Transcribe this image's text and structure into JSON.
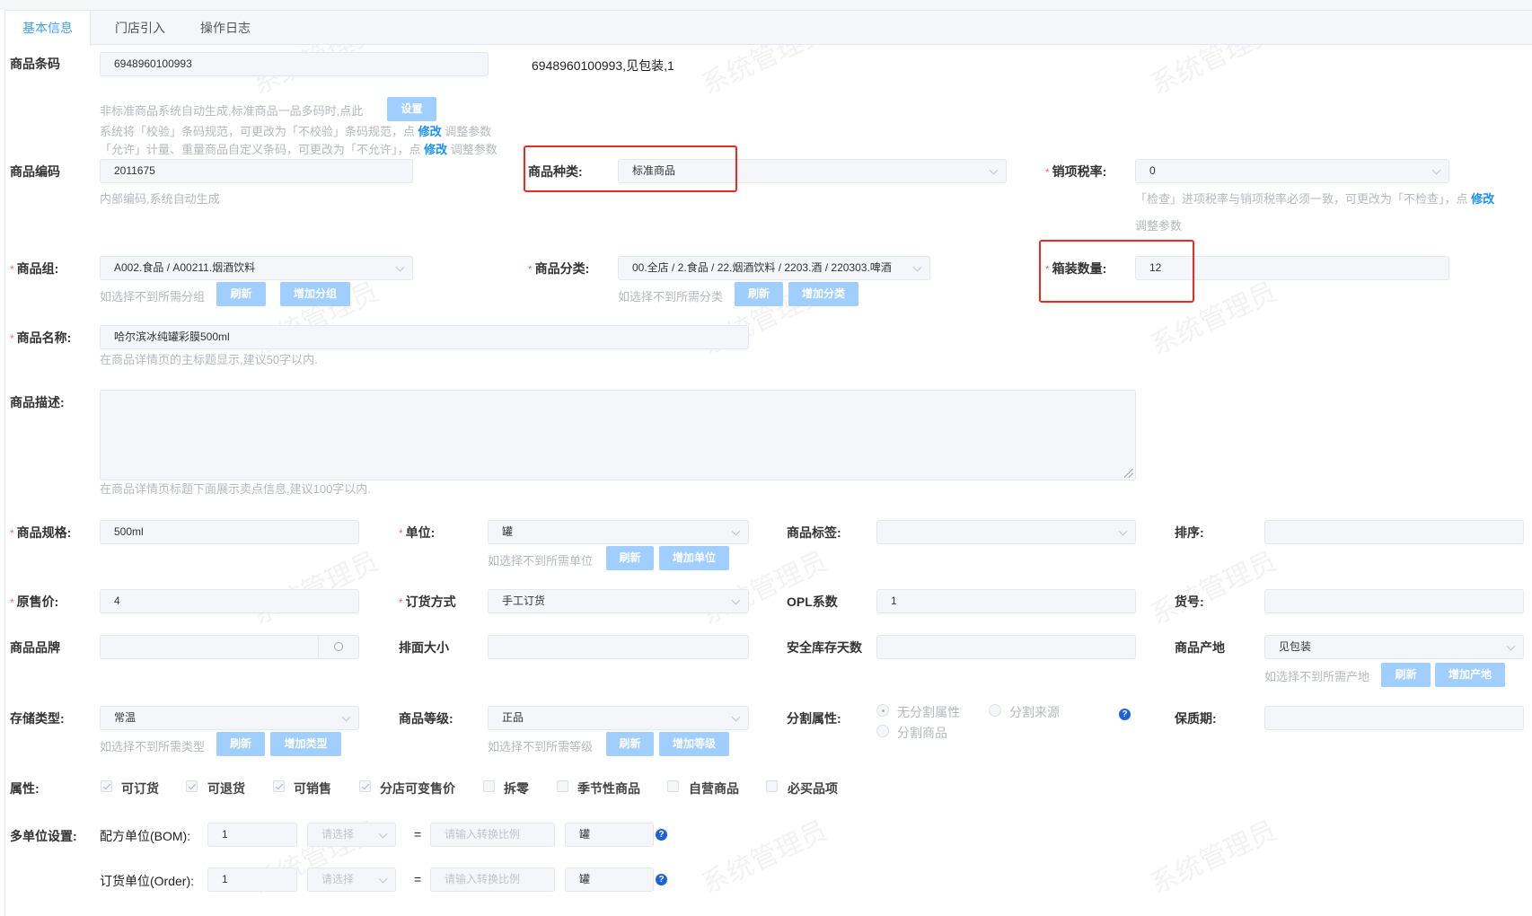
{
  "watermark": "系统管理员",
  "tabs": [
    {
      "label": "基本信息",
      "active": true
    },
    {
      "label": "门店引入"
    },
    {
      "label": "操作日志"
    }
  ],
  "barcode": {
    "label": "商品条码",
    "value": "6948960100993",
    "summary": "6948960100993,见包装,1",
    "hint1": "非标准商品系统自动生成,标准商品一品多码时,点此",
    "set_button": "设置",
    "hint2_pre": "系统将「校验」条码规范，可更改为「不校验」条码规范，点",
    "hint3_pre": "「允许」计量、重量商品自定义条码，可更改为「不允许」，点",
    "modify": "修改",
    "adjust": "调整参数"
  },
  "code": {
    "label": "商品编码",
    "value": "2011675",
    "hint": "内部编码,系统自动生成"
  },
  "kind": {
    "label": "商品种类:",
    "value": "标准商品"
  },
  "tax": {
    "label": "销项税率:",
    "value": "0",
    "hint_pre": "「检查」进项税率与销项税率必须一致，可更改为「不检查」，点",
    "modify": "修改",
    "adjust": "调整参数"
  },
  "group": {
    "label": "商品组:",
    "value": "A002.食品 / A00211.烟酒饮料",
    "hint": "如选择不到所需分组",
    "refresh": "刷新",
    "add": "增加分组"
  },
  "category": {
    "label": "商品分类:",
    "value": "00.全店 / 2.食品 / 22.烟酒饮料 / 2203.酒 / 220303.啤酒",
    "hint": "如选择不到所需分类",
    "refresh": "刷新",
    "add": "增加分类"
  },
  "box_qty": {
    "label": "箱装数量:",
    "value": "12"
  },
  "name": {
    "label": "商品名称:",
    "value": "哈尔滨冰纯罐彩膜500ml",
    "hint": "在商品详情页的主标题显示,建议50字以内."
  },
  "desc": {
    "label": "商品描述:",
    "value": "",
    "hint": "在商品详情页标题下面展示卖点信息,建议100字以内."
  },
  "spec": {
    "label": "商品规格:",
    "value": "500ml"
  },
  "unit": {
    "label": "单位:",
    "value": "罐",
    "hint": "如选择不到所需单位",
    "refresh": "刷新",
    "add": "增加单位"
  },
  "tags": {
    "label": "商品标签:",
    "value": ""
  },
  "sort": {
    "label": "排序:",
    "value": ""
  },
  "price": {
    "label": "原售价:",
    "value": "4"
  },
  "order_mode": {
    "label": "订货方式",
    "value": "手工订货"
  },
  "opl": {
    "label": "OPL系数",
    "value": "1"
  },
  "item_no": {
    "label": "货号:",
    "value": ""
  },
  "brand": {
    "label": "商品品牌",
    "value": ""
  },
  "facing": {
    "label": "排面大小",
    "value": ""
  },
  "safety_days": {
    "label": "安全库存天数",
    "value": ""
  },
  "origin": {
    "label": "商品产地",
    "value": "见包装",
    "hint": "如选择不到所需产地",
    "refresh": "刷新",
    "add": "增加产地"
  },
  "storage": {
    "label": "存储类型:",
    "value": "常温",
    "hint": "如选择不到所需类型",
    "refresh": "刷新",
    "add": "增加类型"
  },
  "grade": {
    "label": "商品等级:",
    "value": "正品",
    "hint": "如选择不到所需等级",
    "refresh": "刷新",
    "add": "增加等级"
  },
  "split": {
    "label": "分割属性:",
    "options": [
      {
        "label": "无分割属性",
        "selected": true
      },
      {
        "label": "分割来源"
      },
      {
        "label": "分割商品"
      }
    ]
  },
  "shelf_life": {
    "label": "保质期:",
    "value": ""
  },
  "attrs": {
    "label": "属性:",
    "items": [
      {
        "label": "可订货",
        "checked": true
      },
      {
        "label": "可退货",
        "checked": true
      },
      {
        "label": "可销售",
        "checked": true
      },
      {
        "label": "分店可变售价",
        "checked": true
      },
      {
        "label": "拆零",
        "checked": false
      },
      {
        "label": "季节性商品",
        "checked": false
      },
      {
        "label": "自营商品",
        "checked": false
      },
      {
        "label": "必买品项",
        "checked": false
      }
    ]
  },
  "multi_unit": {
    "label": "多单位设置:",
    "rows": [
      {
        "label": "配方单位(BOM):",
        "qty": "1",
        "select_placeholder": "请选择",
        "eq": "=",
        "ratio_placeholder": "请输入转换比例",
        "base": "罐"
      },
      {
        "label": "订货单位(Order):",
        "qty": "1",
        "select_placeholder": "请选择",
        "eq": "=",
        "ratio_placeholder": "请输入转换比例",
        "base": "罐"
      }
    ]
  },
  "colors": {
    "accent": "#409eff",
    "button": "#a0cfff",
    "required": "#f56c6c",
    "highlight": "#f0291f"
  }
}
